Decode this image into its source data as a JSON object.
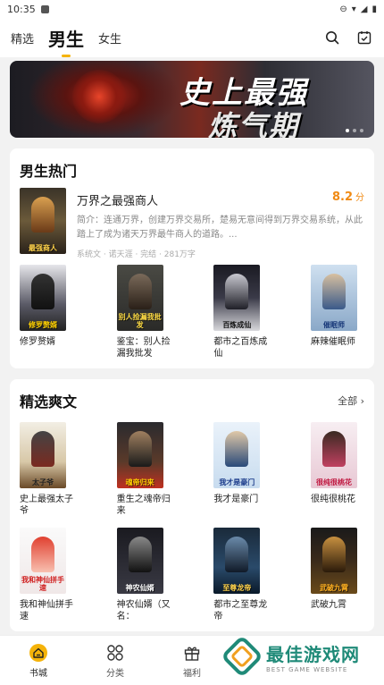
{
  "status_bar": {
    "time": "10:35"
  },
  "header": {
    "tabs": [
      {
        "label": "精选"
      },
      {
        "label": "男生"
      },
      {
        "label": "女生"
      }
    ]
  },
  "banner": {
    "line1": "史上最强",
    "line2": "炼气期"
  },
  "hot_section": {
    "title": "男生热门",
    "featured": {
      "name": "万界之最强商人",
      "score": "8.2",
      "score_unit": "分",
      "intro": "简介：连通万界，创建万界交易所，楚易无意间得到万界交易系统，从此踏上了成为诸天万界最牛商人的道路。...",
      "meta": "系统文 · 诺天涯 · 完结 · 281万字",
      "cover_text": "最强商人"
    },
    "books": [
      {
        "title": "修罗赘婿",
        "cover_text": "修罗赘婿"
      },
      {
        "title": "鉴宝：别人捡漏我批发",
        "cover_text": "别人捡漏我批发"
      },
      {
        "title": "都市之百炼成仙",
        "cover_text": "百炼成仙"
      },
      {
        "title": "麻辣催眠师",
        "cover_text": "催眠师"
      }
    ]
  },
  "picks_section": {
    "title": "精选爽文",
    "more_label": "全部",
    "books": [
      {
        "title": "史上最强太子爷",
        "cover_text": "太子爷"
      },
      {
        "title": "重生之魂帝归来",
        "cover_text": "魂帝归来"
      },
      {
        "title": "我才是豪门",
        "cover_text": "我才是豪门"
      },
      {
        "title": "很纯很桃花",
        "cover_text": "很纯很桃花"
      },
      {
        "title": "我和神仙拼手速",
        "cover_text": "我和神仙拼手速"
      },
      {
        "title": "神农仙婿（又名：",
        "cover_text": "神农仙婿"
      },
      {
        "title": "都市之至尊龙帝",
        "cover_text": "至尊龙帝"
      },
      {
        "title": "武破九霄",
        "cover_text": "武破九霄"
      }
    ]
  },
  "bottom_nav": [
    {
      "label": "书城",
      "icon": "home-icon"
    },
    {
      "label": "分类",
      "icon": "grid-icon"
    },
    {
      "label": "福利",
      "icon": "gift-icon"
    }
  ],
  "watermark": {
    "main": "最佳游戏网",
    "sub": "BEST GAME WEBSITE"
  },
  "colors": {
    "accent": "#f5b30a",
    "score": "#f08a14",
    "watermark": "#1f8a78"
  }
}
